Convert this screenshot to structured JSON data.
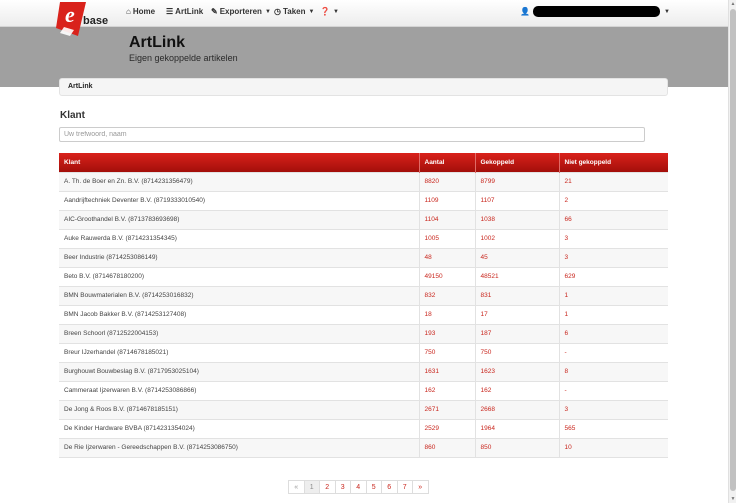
{
  "logo": {
    "letter": "e",
    "text": "base",
    "accent": "#d9221b"
  },
  "nav": {
    "home": {
      "label": "Home",
      "icon": "home-icon"
    },
    "artlink": {
      "label": "ArtLink",
      "icon": "list-icon"
    },
    "exporteren": {
      "label": "Exporteren",
      "icon": "edit-icon"
    },
    "taken": {
      "label": "Taken",
      "icon": "clock-icon"
    },
    "help": {
      "label": "",
      "icon": "help-icon"
    },
    "user_icon": "user-icon"
  },
  "header": {
    "title": "ArtLink",
    "subtitle": "Eigen gekoppelde artikelen"
  },
  "breadcrumb": {
    "item": "ArtLink"
  },
  "filter": {
    "label": "Klant",
    "placeholder": "Uw trefwoord, naam"
  },
  "table": {
    "headers": [
      "Klant",
      "Aantal",
      "Gekoppeld",
      "Niet gekoppeld"
    ],
    "rows": [
      [
        "A. Th. de Boer en Zn. B.V. (8714231356479)",
        "8820",
        "8799",
        "21"
      ],
      [
        "Aandrijftechniek Deventer B.V. (8719333010540)",
        "1109",
        "1107",
        "2"
      ],
      [
        "AIC-Groothandel B.V. (8713783693698)",
        "1104",
        "1038",
        "66"
      ],
      [
        "Auke Rauwerda B.V. (8714231354345)",
        "1005",
        "1002",
        "3"
      ],
      [
        "Beer Industrie (8714253086149)",
        "48",
        "45",
        "3"
      ],
      [
        "Beto B.V. (8714678180200)",
        "49150",
        "48521",
        "629"
      ],
      [
        "BMN Bouwmaterialen B.V. (8714253016832)",
        "832",
        "831",
        "1"
      ],
      [
        "BMN Jacob Bakker B.V. (8714253127408)",
        "18",
        "17",
        "1"
      ],
      [
        "Breen Schoorl (8712522004153)",
        "193",
        "187",
        "6"
      ],
      [
        "Breur IJzerhandel (8714678185021)",
        "750",
        "750",
        "-"
      ],
      [
        "Burghouwt Bouwbeslag B.V. (8717953025104)",
        "1631",
        "1623",
        "8"
      ],
      [
        "Cammeraat Ijzerwaren B.V. (8714253086866)",
        "162",
        "162",
        "-"
      ],
      [
        "De Jong & Roos B.V. (8714678185151)",
        "2671",
        "2668",
        "3"
      ],
      [
        "De Kinder Hardware BVBA (8714231354024)",
        "2529",
        "1964",
        "565"
      ],
      [
        "De Rie Ijzerwaren - Gereedschappen B.V. (8714253086750)",
        "860",
        "850",
        "10"
      ]
    ]
  },
  "pagination": {
    "prev": "«",
    "pages": [
      "1",
      "2",
      "3",
      "4",
      "5",
      "6",
      "7"
    ],
    "next": "»",
    "active": "1"
  },
  "colors": {
    "header_band": "#a0a0a0",
    "table_header": "#c0150f",
    "number_text": "#c9261d"
  }
}
